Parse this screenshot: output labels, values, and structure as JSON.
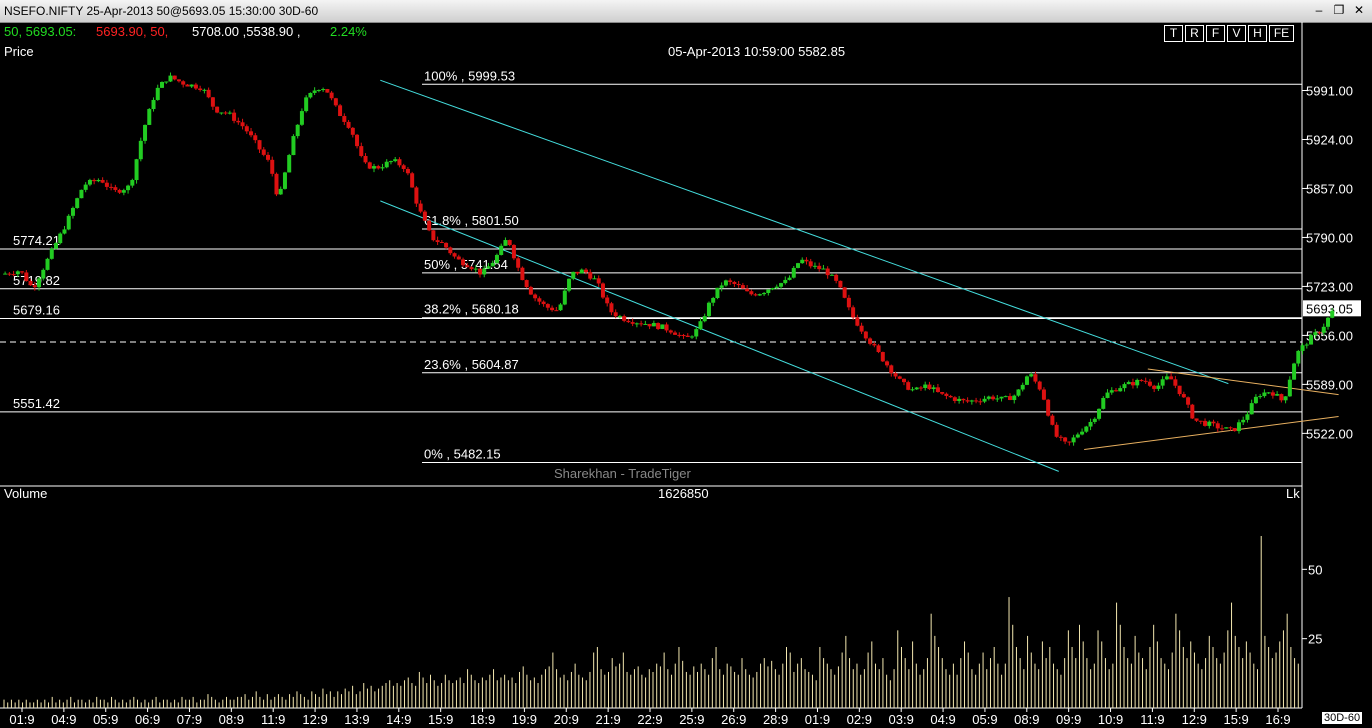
{
  "window": {
    "title": "NSEFO.NIFTY 25-Apr-2013 50@5693.05 15:30:00 30D-60"
  },
  "quote": {
    "p1": "50, 5693.05:",
    "p2": "5693.90, 50,",
    "p3": "5708.00 ,5538.90 ,",
    "p4": "2.24%"
  },
  "toolbar": {
    "buttons": [
      "T",
      "R",
      "F",
      "V",
      "H",
      "FE"
    ]
  },
  "price_panel": {
    "label": "Price",
    "crosshair_info": "05-Apr-2013 10:59:00 5582.85"
  },
  "volume_panel": {
    "label": "Volume",
    "value": "1626850",
    "unit": "Lk",
    "period_tag": "30D-60"
  },
  "watermark": "Sharekhan - TradeTiger",
  "colors": {
    "bull": "#22cc22",
    "bear": "#dd1111",
    "channel": "#44dddd",
    "triangle": "#e8b060",
    "volume": "#f4e8b0"
  },
  "chart_data": [
    {
      "type": "candlestick",
      "ylim": [
        5450,
        6030
      ],
      "x_ticks": [
        "01:9",
        "04:9",
        "05:9",
        "06:9",
        "07:9",
        "08:9",
        "11:9",
        "12:9",
        "13:9",
        "14:9",
        "15:9",
        "18:9",
        "19:9",
        "20:9",
        "21:9",
        "22:9",
        "25:9",
        "26:9",
        "28:9",
        "01:9",
        "02:9",
        "03:9",
        "04:9",
        "05:9",
        "08:9",
        "09:9",
        "10:9",
        "11:9",
        "12:9",
        "15:9",
        "16:9"
      ],
      "y_ticks": [
        "5991.00",
        "5924.00",
        "5857.00",
        "5790.00",
        "5723.00",
        "5656.00",
        "5589.00",
        "5522.00"
      ],
      "last_price": "5693.05",
      "levels": [
        {
          "label": "5774.21",
          "value": 5774.21
        },
        {
          "label": "5719.82",
          "value": 5719.82
        },
        {
          "label": "5679.16",
          "value": 5679.16
        },
        {
          "label": "5551.42",
          "value": 5551.42
        }
      ],
      "dashed_level": 5647,
      "fibonacci": [
        {
          "label": "100%  , 5999.53",
          "value": 5999.53
        },
        {
          "label": "61.8%  , 5801.50",
          "value": 5801.5
        },
        {
          "label": "50%  , 5741.54",
          "value": 5741.54
        },
        {
          "label": "38.2%  , 5680.18",
          "value": 5680.18
        },
        {
          "label": "23.6%  , 5604.87",
          "value": 5604.87
        },
        {
          "label": "0%  , 5482.15",
          "value": 5482.15
        }
      ],
      "close_path": [
        [
          0,
          5740
        ],
        [
          8,
          5745
        ],
        [
          14,
          5720
        ],
        [
          22,
          5765
        ],
        [
          30,
          5810
        ],
        [
          38,
          5862
        ],
        [
          46,
          5870
        ],
        [
          52,
          5852
        ],
        [
          60,
          5860
        ],
        [
          66,
          5935
        ],
        [
          72,
          5990
        ],
        [
          78,
          6010
        ],
        [
          86,
          6000
        ],
        [
          94,
          5995
        ],
        [
          100,
          5965
        ],
        [
          106,
          5960
        ],
        [
          114,
          5940
        ],
        [
          120,
          5915
        ],
        [
          126,
          5890
        ],
        [
          130,
          5840
        ],
        [
          136,
          5915
        ],
        [
          142,
          5975
        ],
        [
          148,
          5995
        ],
        [
          152,
          5995
        ],
        [
          158,
          5962
        ],
        [
          164,
          5940
        ],
        [
          170,
          5890
        ],
        [
          176,
          5885
        ],
        [
          184,
          5895
        ],
        [
          190,
          5885
        ],
        [
          196,
          5830
        ],
        [
          202,
          5790
        ],
        [
          208,
          5780
        ],
        [
          214,
          5760
        ],
        [
          220,
          5752
        ],
        [
          226,
          5740
        ],
        [
          232,
          5760
        ],
        [
          238,
          5790
        ],
        [
          244,
          5740
        ],
        [
          250,
          5710
        ],
        [
          256,
          5695
        ],
        [
          262,
          5690
        ],
        [
          268,
          5740
        ],
        [
          274,
          5745
        ],
        [
          280,
          5730
        ],
        [
          286,
          5690
        ],
        [
          292,
          5680
        ],
        [
          298,
          5675
        ],
        [
          304,
          5672
        ],
        [
          310,
          5668
        ],
        [
          316,
          5662
        ],
        [
          322,
          5650
        ],
        [
          328,
          5665
        ],
        [
          334,
          5705
        ],
        [
          340,
          5730
        ],
        [
          346,
          5725
        ],
        [
          352,
          5712
        ],
        [
          358,
          5715
        ],
        [
          364,
          5725
        ],
        [
          370,
          5730
        ],
        [
          376,
          5760
        ],
        [
          382,
          5750
        ],
        [
          388,
          5745
        ],
        [
          394,
          5725
        ],
        [
          400,
          5685
        ],
        [
          406,
          5660
        ],
        [
          412,
          5635
        ],
        [
          418,
          5612
        ],
        [
          424,
          5590
        ],
        [
          430,
          5580
        ],
        [
          436,
          5588
        ],
        [
          442,
          5575
        ],
        [
          448,
          5570
        ],
        [
          454,
          5565
        ],
        [
          460,
          5568
        ],
        [
          466,
          5572
        ],
        [
          472,
          5568
        ],
        [
          478,
          5575
        ],
        [
          484,
          5605
        ],
        [
          490,
          5580
        ],
        [
          496,
          5520
        ],
        [
          502,
          5505
        ],
        [
          508,
          5525
        ],
        [
          514,
          5540
        ],
        [
          520,
          5575
        ],
        [
          526,
          5585
        ],
        [
          532,
          5590
        ],
        [
          538,
          5595
        ],
        [
          544,
          5585
        ],
        [
          550,
          5600
        ],
        [
          556,
          5575
        ],
        [
          562,
          5540
        ],
        [
          568,
          5535
        ],
        [
          574,
          5530
        ],
        [
          580,
          5525
        ],
        [
          586,
          5545
        ],
        [
          592,
          5575
        ],
        [
          598,
          5580
        ],
        [
          604,
          5565
        ],
        [
          610,
          5630
        ],
        [
          616,
          5650
        ],
        [
          622,
          5665
        ],
        [
          628,
          5693.05
        ]
      ],
      "channel": {
        "upper": [
          [
            0,
            6005
          ],
          [
            400,
            5590
          ]
        ],
        "lower": [
          [
            0,
            5840
          ],
          [
            320,
            5470
          ]
        ]
      },
      "triangle": {
        "upper": [
          [
            540,
            5610
          ],
          [
            630,
            5575
          ]
        ],
        "lower": [
          [
            510,
            5500
          ],
          [
            630,
            5545
          ]
        ]
      }
    },
    {
      "type": "bar",
      "y_ticks": [
        "50",
        "25"
      ],
      "ylim": [
        0,
        75
      ],
      "values": [
        3,
        2,
        3,
        2,
        3,
        2,
        3,
        2,
        2,
        3,
        2,
        3,
        2,
        4,
        2,
        3,
        2,
        3,
        4,
        2,
        3,
        3,
        2,
        3,
        2,
        4,
        3,
        3,
        2,
        4,
        3,
        2,
        3,
        2,
        3,
        4,
        3,
        2,
        3,
        2,
        3,
        4,
        2,
        3,
        3,
        2,
        3,
        2,
        4,
        3,
        3,
        4,
        2,
        3,
        3,
        5,
        4,
        3,
        2,
        3,
        4,
        3,
        3,
        4,
        4,
        5,
        3,
        4,
        6,
        4,
        3,
        5,
        3,
        4,
        5,
        4,
        3,
        5,
        4,
        6,
        5,
        4,
        3,
        6,
        5,
        4,
        7,
        5,
        6,
        4,
        6,
        5,
        7,
        6,
        8,
        5,
        6,
        9,
        7,
        8,
        6,
        7,
        8,
        9,
        10,
        8,
        9,
        8,
        10,
        11,
        9,
        8,
        13,
        11,
        9,
        12,
        10,
        8,
        9,
        12,
        10,
        9,
        10,
        11,
        9,
        14,
        12,
        10,
        9,
        11,
        10,
        12,
        14,
        10,
        11,
        12,
        10,
        11,
        9,
        13,
        15,
        12,
        10,
        11,
        9,
        12,
        14,
        15,
        20,
        14,
        11,
        12,
        10,
        13,
        16,
        12,
        11,
        10,
        13,
        20,
        22,
        14,
        12,
        13,
        18,
        15,
        16,
        20,
        13,
        12,
        14,
        15,
        12,
        11,
        14,
        13,
        16,
        15,
        20,
        14,
        12,
        16,
        22,
        17,
        13,
        12,
        15,
        13,
        16,
        14,
        12,
        18,
        22,
        14,
        12,
        16,
        15,
        13,
        12,
        18,
        14,
        12,
        11,
        13,
        16,
        18,
        15,
        17,
        14,
        12,
        16,
        22,
        20,
        13,
        16,
        18,
        14,
        13,
        12,
        10,
        22,
        18,
        16,
        14,
        12,
        15,
        20,
        26,
        18,
        14,
        16,
        12,
        14,
        20,
        24,
        16,
        14,
        18,
        12,
        10,
        14,
        28,
        22,
        18,
        14,
        24,
        16,
        12,
        14,
        18,
        34,
        26,
        22,
        18,
        14,
        12,
        16,
        12,
        18,
        24,
        20,
        14,
        12,
        16,
        20,
        14,
        18,
        22,
        16,
        12,
        16,
        40,
        30,
        22,
        18,
        14,
        26,
        20,
        16,
        14,
        24,
        18,
        22,
        16,
        14,
        12,
        18,
        28,
        22,
        18,
        30,
        24,
        18,
        14,
        16,
        28,
        24,
        18,
        14,
        16,
        38,
        30,
        22,
        18,
        16,
        26,
        20,
        18,
        14,
        22,
        30,
        24,
        18,
        16,
        14,
        20,
        34,
        28,
        22,
        18,
        24,
        20,
        16,
        14,
        18,
        26,
        22,
        18,
        16,
        20,
        28,
        38,
        26,
        22,
        18,
        24,
        20,
        16,
        14,
        62,
        26,
        22,
        18,
        20,
        24,
        28,
        34,
        22,
        18,
        16
      ]
    }
  ]
}
